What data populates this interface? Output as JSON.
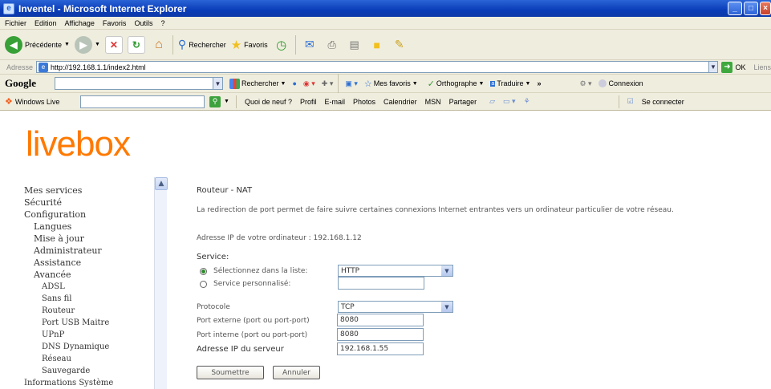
{
  "window": {
    "title": "Inventel - Microsoft Internet Explorer"
  },
  "menubar": {
    "items": [
      "Fichier",
      "Edition",
      "Affichage",
      "Favoris",
      "Outils",
      "?"
    ]
  },
  "toolbar": {
    "back_label": "Précédente",
    "search_label": "Rechercher",
    "favorites_label": "Favoris"
  },
  "address": {
    "label": "Adresse",
    "url": "http://192.168.1.1/index2.html",
    "go_label": "OK",
    "links_label": "Liens"
  },
  "google": {
    "logo": "Google",
    "search_label": "Rechercher",
    "favorites_label": "Mes favoris",
    "spell_label": "Orthographe",
    "translate_label": "Traduire",
    "more": "»",
    "connect_label": "Connexion"
  },
  "live": {
    "logo": "Windows Live",
    "links": [
      "Quoi de neuf ?",
      "Profil",
      "E-mail",
      "Photos",
      "Calendrier",
      "MSN",
      "Partager"
    ],
    "signin_label": "Se connecter"
  },
  "page": {
    "logo": "livebox",
    "menu": [
      {
        "label": "Mes services",
        "level": 0
      },
      {
        "label": "Sécurité",
        "level": 0
      },
      {
        "label": "Configuration",
        "level": 0
      },
      {
        "label": "Langues",
        "level": 1
      },
      {
        "label": "Mise à jour",
        "level": 1
      },
      {
        "label": "Administrateur",
        "level": 1
      },
      {
        "label": "Assistance",
        "level": 1
      },
      {
        "label": "Avancée",
        "level": 1
      },
      {
        "label": "ADSL",
        "level": 2
      },
      {
        "label": "Sans fil",
        "level": 2
      },
      {
        "label": "Routeur",
        "level": 2
      },
      {
        "label": "Port USB Maitre",
        "level": 2
      },
      {
        "label": "UPnP",
        "level": 2
      },
      {
        "label": "DNS Dynamique",
        "level": 2
      },
      {
        "label": "Réseau",
        "level": 2
      },
      {
        "label": "Sauvegarde",
        "level": 2
      },
      {
        "label": "Informations Système",
        "level": 0
      }
    ],
    "title": "Routeur - NAT",
    "description": "La redirection de port permet de faire suivre certaines connexions Internet entrantes vers un ordinateur particulier de votre réseau.",
    "ip_line": "Adresse IP de votre ordinateur : 192.168.1.12",
    "service_label": "Service:",
    "radio_list_label": "Sélectionnez dans la liste:",
    "radio_list_value": "HTTP",
    "radio_custom_label": "Service personnalisé:",
    "radio_custom_value": "",
    "protocol_label": "Protocole",
    "protocol_value": "TCP",
    "ext_port_label": "Port externe (port ou port-port)",
    "ext_port_value": "8080",
    "int_port_label": "Port interne (port ou port-port)",
    "int_port_value": "8080",
    "server_ip_label": "Adresse IP du serveur",
    "server_ip_value": "192.168.1.55",
    "submit_label": "Soumettre",
    "cancel_label": "Annuler"
  }
}
